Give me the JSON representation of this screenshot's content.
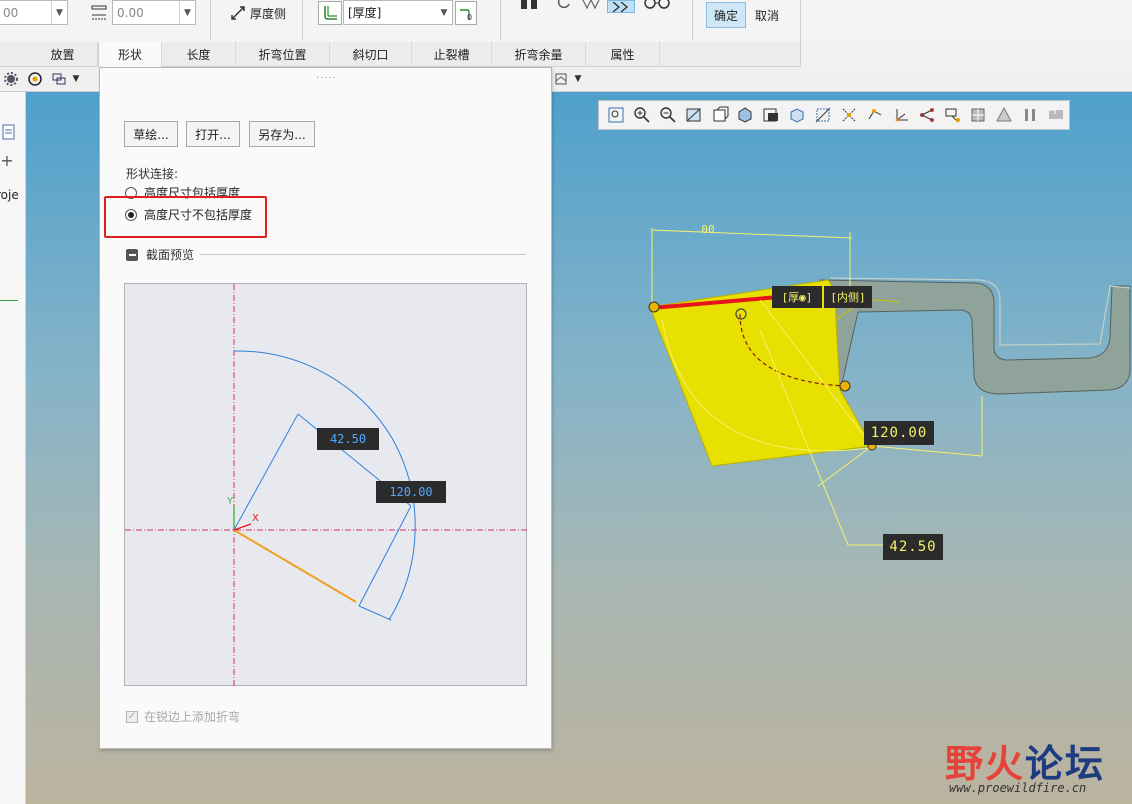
{
  "ribbon": {
    "field1_value": "00",
    "field2_value": "0.00",
    "thickness_side_label": "厚度侧",
    "thickness_select_value": "[厚度]",
    "ok_label": "确定",
    "cancel_label": "取消"
  },
  "tabs": [
    {
      "label": "放置"
    },
    {
      "label": "形状"
    },
    {
      "label": "长度"
    },
    {
      "label": "折弯位置"
    },
    {
      "label": "斜切口"
    },
    {
      "label": "止裂槽"
    },
    {
      "label": "折弯余量"
    },
    {
      "label": "属性"
    }
  ],
  "left_strip": {
    "partial_label": "roje"
  },
  "panel": {
    "sketch_button": "草绘...",
    "open_button": "打开...",
    "save_as_button": "另存为...",
    "shape_connection_label": "形状连接:",
    "option_include": "高度尺寸包括厚度",
    "option_exclude": "高度尺寸不包括厚度",
    "section_preview_label": "截面预览",
    "preview_dim_a": "42.50",
    "preview_dim_b": "120.00",
    "axis_y": "Y",
    "axis_x": "X",
    "add_bend_label": "在锐边上添加折弯"
  },
  "model": {
    "top_dim": "00",
    "tag_thickness": "[厚◉]",
    "tag_inside": "[内侧]",
    "dim_120": "120.00",
    "dim_42": "42.50"
  },
  "watermark": {
    "text_a": "野",
    "text_b": "火",
    "text_c": "论坛",
    "url": "www.proewildfire.cn"
  },
  "colors": {
    "accent_ok": "#cfe6f7",
    "highlight_red": "#e0201e",
    "flange_yellow": "#e8e000",
    "base_grey": "#8fa39b",
    "edge_red": "#e8141c",
    "preview_blue": "#2f7fdc",
    "preview_orange": "#f0a020"
  }
}
